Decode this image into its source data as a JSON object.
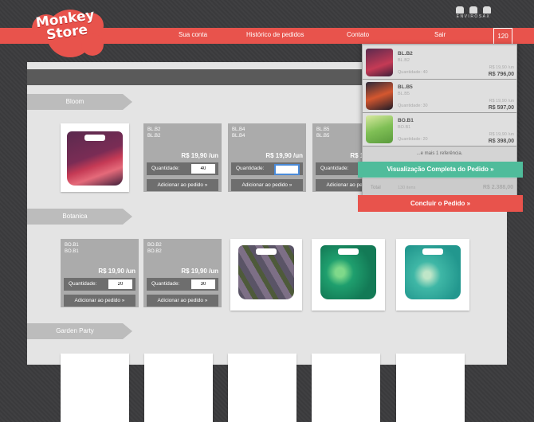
{
  "brand": {
    "logo_text": "Monkey Store",
    "partner": "ENVIROSAX"
  },
  "nav": {
    "account": "Sua conta",
    "history": "Histórico de pedidos",
    "contact": "Contato",
    "logout": "Sair"
  },
  "cart": {
    "count": "120"
  },
  "categories": {
    "bloom": "Bloom",
    "botanica": "Botanica",
    "garden": "Garden Party"
  },
  "labels": {
    "quantity": "Quantidade:",
    "add": "Adicionar ao pedido »"
  },
  "bloom_cards": [
    {
      "code": "BL.B2",
      "code2": "BL.B2",
      "price": "R$ 19,90 /un",
      "qty": "40"
    },
    {
      "code": "BL.B4",
      "code2": "BL.B4",
      "price": "R$ 19,90 /un",
      "qty": ""
    },
    {
      "code": "BL.B5",
      "code2": "BL.B5",
      "price": "R$ 19,90 /un",
      "qty": ""
    }
  ],
  "botanica_cards": [
    {
      "code": "BO.B1",
      "code2": "BO.B1",
      "price": "R$ 19,90 /un",
      "qty": "20"
    },
    {
      "code": "BO.B2",
      "code2": "BO.B2",
      "price": "R$ 19,90 /un",
      "qty": "30"
    }
  ],
  "cart_dropdown": {
    "items": [
      {
        "code": "BL.B2",
        "code2": "BL.B2",
        "qty": "Quantidade: 40",
        "unit": "R$ 19,90 /un",
        "total": "R$ 796,00"
      },
      {
        "code": "BL.B5",
        "code2": "BL.B5",
        "qty": "Quantidade: 30",
        "unit": "R$ 19,90 /un",
        "total": "R$ 597,00"
      },
      {
        "code": "BO.B1",
        "code2": "BO.B1",
        "qty": "Quantidade: 20",
        "unit": "R$ 19,90 /un",
        "total": "R$ 398,00"
      }
    ],
    "more": "...e mais 1 referência.",
    "total_label": "Total",
    "total_items": "130 itens",
    "total_value": "R$ 2.388,00",
    "view_button": "Visualização Completa do Pedido »",
    "finish_button": "Concluir o Pedido »"
  },
  "colors": {
    "accent": "#e8534c",
    "green": "#4fbc9b",
    "bg": "#3a3a3c"
  }
}
